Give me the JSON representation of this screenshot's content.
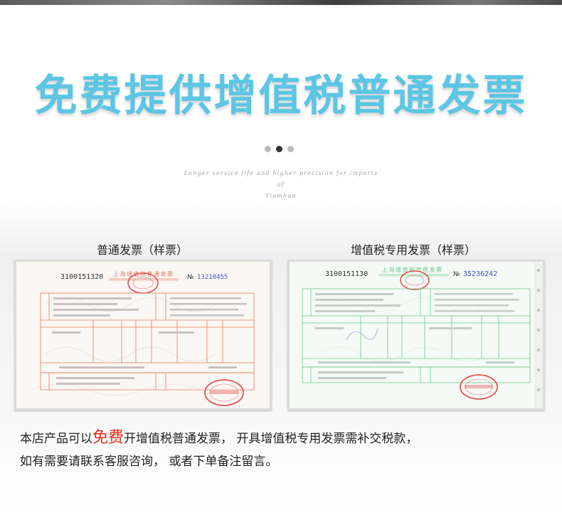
{
  "headline": "免费提供增值税普通发票",
  "tagline": {
    "line1": "Longer service life and higher precision for imports of",
    "line2": "Tiemhun"
  },
  "carousel": {
    "count": 3,
    "active_index": 1
  },
  "cards": {
    "general": {
      "caption": "普通发票（样票）",
      "invoice_title": "上海增值税普通发票",
      "code": "3100151320",
      "no_prefix": "№",
      "number": "13210455"
    },
    "special": {
      "caption": "增值税专用发票（样票）",
      "invoice_title": "上海增值税专用发票",
      "code": "3100151130",
      "no_prefix": "№",
      "number": "35236242"
    }
  },
  "note": {
    "line1_before": "本店产品可以",
    "line1_highlight": "免费",
    "line1_after": "开增值税普通发票， 开具增值税专用发票需补交税款，",
    "line2": "如有需要请联系客服咨询， 或者下单备注留言。"
  },
  "colors": {
    "headline": "#5cc6e4",
    "highlight": "#e8291f",
    "general_line": "#e8795e",
    "special_line": "#6cc98a",
    "stamp": "#e0353a",
    "number": "#3a55c8"
  }
}
